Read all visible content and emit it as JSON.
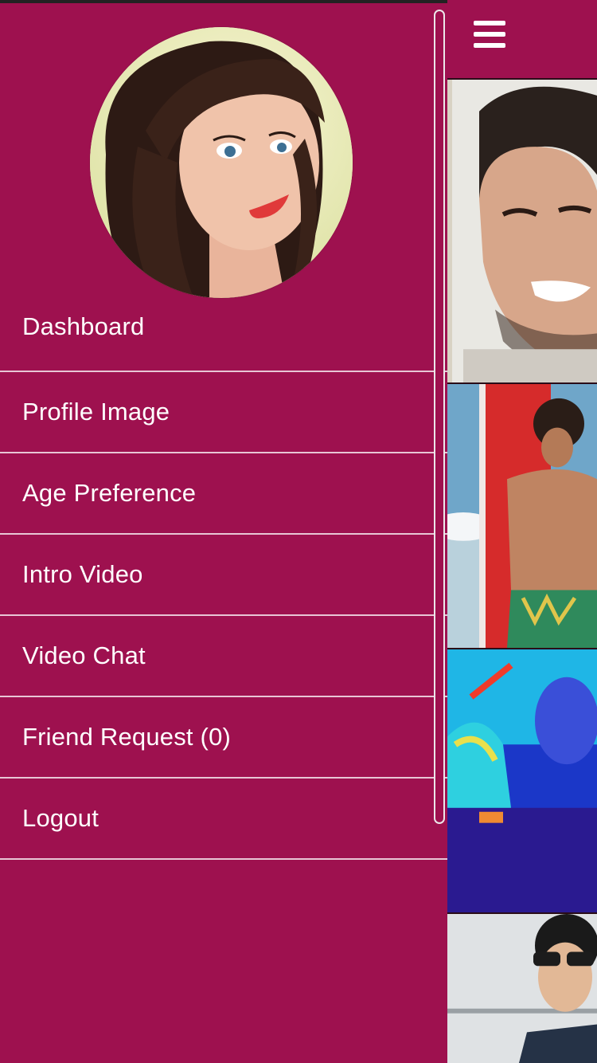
{
  "drawer": {
    "items": [
      {
        "label": "Dashboard"
      },
      {
        "label": "Profile Image"
      },
      {
        "label": "Age Preference"
      },
      {
        "label": "Intro Video"
      },
      {
        "label": "Video Chat"
      },
      {
        "label": "Friend Request (0)"
      },
      {
        "label": "Logout"
      }
    ]
  },
  "icons": {
    "menu": "hamburger-menu-icon",
    "avatar": "user-avatar"
  },
  "colors": {
    "brand": "#9e114f",
    "divider": "#e8c6d5",
    "text": "#ffffff"
  }
}
